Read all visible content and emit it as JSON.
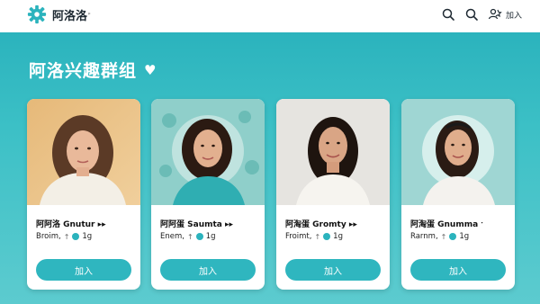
{
  "header": {
    "brand_name": "阿洛洛",
    "brand_sup": "ᵖ",
    "join_label": "加入",
    "icons": [
      "gear-icon",
      "search-icon",
      "search-icon",
      "group-icon"
    ]
  },
  "page": {
    "title": "阿洛兴趣群组",
    "title_icon": "♥"
  },
  "colors": {
    "accent": "#2bb3bd",
    "button": "#2fb6bf"
  },
  "cards": [
    {
      "name": "阿阿洛 Gnutur ▸▸",
      "meta_a": "Broim,",
      "meta_b": "1g",
      "button": "加入"
    },
    {
      "name": "阿阿蛋 Saumta ▸▸",
      "meta_a": "Enem,",
      "meta_b": "1g",
      "button": "加入"
    },
    {
      "name": "阿淘蛋 Gromty ▸▸",
      "meta_a": "Froimt,",
      "meta_b": "1g",
      "button": "加入"
    },
    {
      "name": "阿淘蛋 Gnumma ˑ",
      "meta_a": "Rarnm,",
      "meta_b": "1g",
      "button": "加入"
    }
  ]
}
